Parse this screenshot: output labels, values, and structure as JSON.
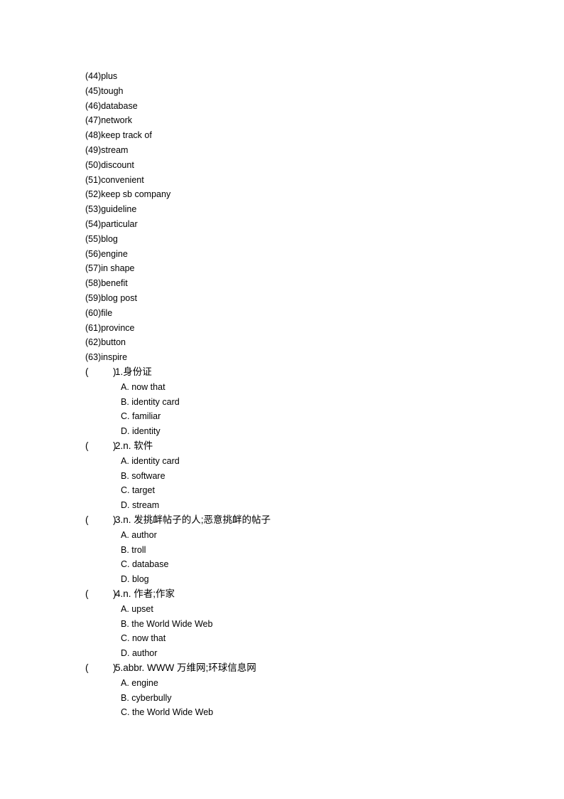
{
  "vocabulary": [
    "(44)plus",
    "(45)tough",
    "(46)database",
    "(47)network",
    "(48)keep track of",
    "(49)stream",
    "(50)discount",
    "(51)convenient",
    "(52)keep sb company",
    "(53)guideline",
    "(54)particular",
    "(55)blog",
    "(56)engine",
    "(57)in shape",
    "(58)benefit",
    "(59)blog post",
    "(60)file",
    "(61)province",
    "(62)button",
    "(63)inspire"
  ],
  "paren_open": "(",
  "paren_close": ")",
  "questions": [
    {
      "stem": "1.身份证",
      "options": [
        "A. now that",
        "B. identity card",
        "C. familiar",
        "D. identity"
      ]
    },
    {
      "stem": "2.n.  软件",
      "options": [
        "A. identity card",
        "B. software",
        "C. target",
        "D. stream"
      ]
    },
    {
      "stem": "3.n.  发挑衅帖子的人;恶意挑衅的帖子",
      "options": [
        "A. author",
        "B. troll",
        "C. database",
        "D. blog"
      ]
    },
    {
      "stem": "4.n.  作者;作家",
      "options": [
        "A. upset",
        "B. the World Wide Web",
        "C. now that",
        "D. author"
      ]
    },
    {
      "stem": "5.abbr. WWW 万维网;环球信息网",
      "options": [
        "A. engine",
        "B. cyberbully",
        "C. the World Wide Web"
      ]
    }
  ]
}
